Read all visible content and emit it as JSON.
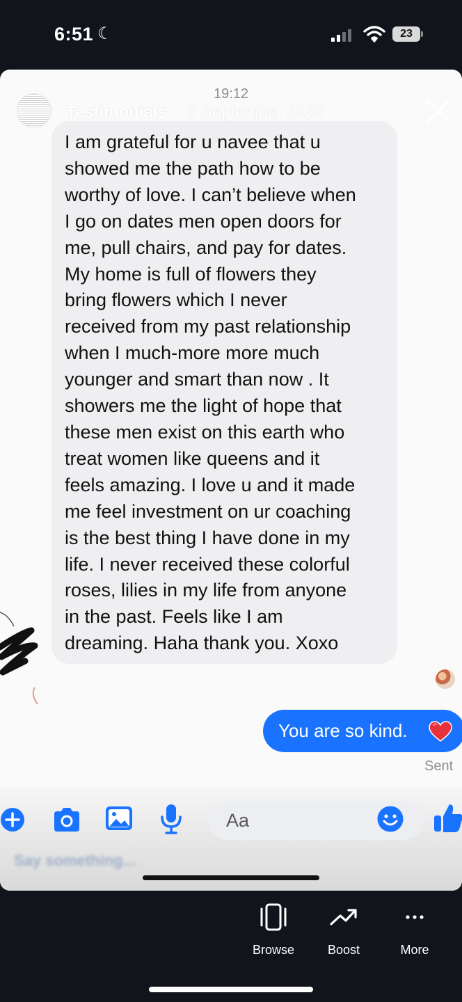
{
  "status_bar": {
    "time": "6:51",
    "battery": "23"
  },
  "story": {
    "account_name": "Testimonials",
    "date": "5 September 2024",
    "segments": 11
  },
  "chat": {
    "timestamp": "19:12",
    "received_message": "I am grateful for u navee that u\nshowed me the path how to be\nworthy of love. I can’t believe when\nI go on dates men open doors for\nme, pull chairs, and pay for dates.\nMy home is full of flowers they\nbring flowers which I never\nreceived from my past relationship\nwhen I much-more more much\nyounger and smart than now . It\nshowers me the light of hope that\nthese men exist on this earth who\ntreat women like queens and it\nfeels amazing. I love u and it made\nme feel investment on ur coaching\nis the best thing I have done in my\nlife. I never received these colorful\nroses, lilies in my life from anyone\nin the past. Feels like I am\ndreaming. Haha thank you. Xoxo",
    "sent_message": "You are so kind.",
    "sent_status": "Sent"
  },
  "composer": {
    "placeholder": "Aa",
    "reply_hint": "Say something..."
  },
  "actions": {
    "browse": "Browse",
    "boost": "Boost",
    "more": "More"
  },
  "colors": {
    "messenger_blue": "#1a73ff",
    "received_bubble": "#efeff1",
    "heart": "#e8323b"
  }
}
